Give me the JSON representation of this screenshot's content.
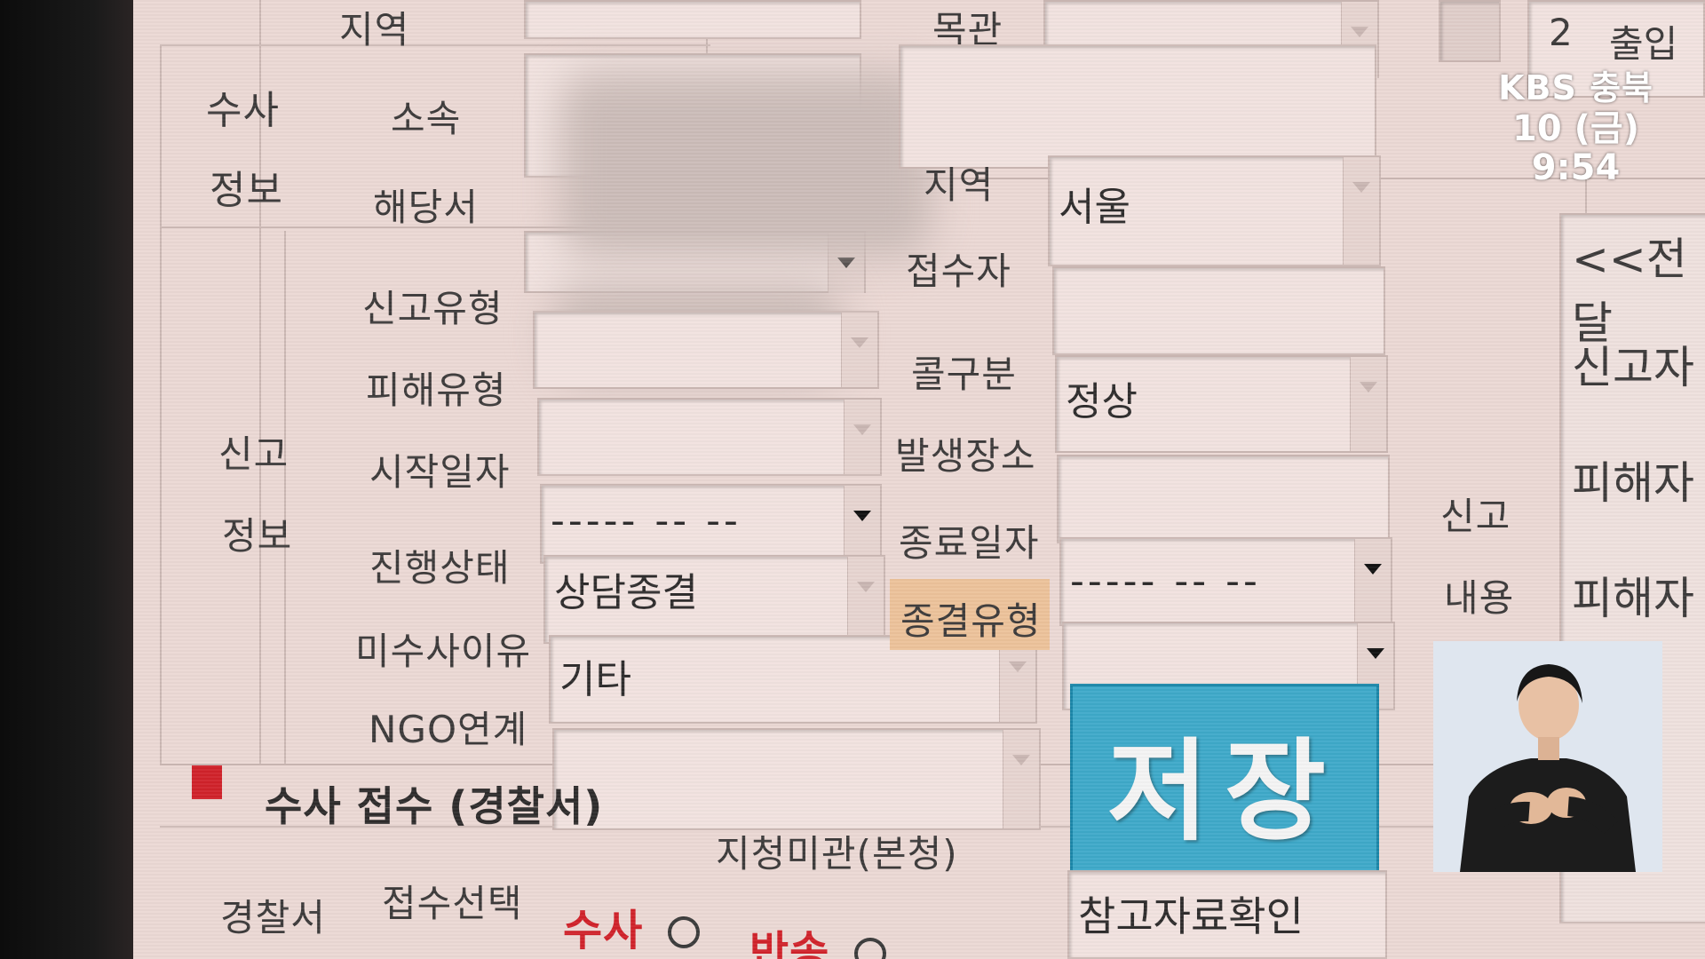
{
  "investigation_section": {
    "heading_line1": "수사",
    "heading_line2": "정보",
    "top_region_label": "지역",
    "affiliation_label": "소속",
    "station_label": "해당서",
    "top_right_label": "목관",
    "top_right_number": "2",
    "top_right_word": "출입"
  },
  "report_section": {
    "heading_line1": "신고",
    "heading_line2": "정보",
    "left_fields": [
      {
        "label": "신고유형",
        "value": ""
      },
      {
        "label": "피해유형",
        "value": ""
      },
      {
        "label": "시작일자",
        "value": "----- -- --"
      },
      {
        "label": "진행상태",
        "value": "상담종결"
      },
      {
        "label": "미수사이유",
        "value": "기타"
      },
      {
        "label": "NGO연계",
        "value": ""
      }
    ],
    "right_fields": [
      {
        "label": "지역",
        "value": "서울"
      },
      {
        "label": "접수자",
        "value": ""
      },
      {
        "label": "콜구분",
        "value": "정상"
      },
      {
        "label": "발생장소",
        "value": ""
      },
      {
        "label": "종료일자",
        "value": "----- -- --"
      },
      {
        "label": "종결유형",
        "value": ""
      }
    ]
  },
  "save_button": {
    "label": "저장"
  },
  "report_content": {
    "heading_line1": "신고",
    "heading_line2": "내용",
    "lines": [
      "<<전달",
      "신고자",
      "피해자",
      "피해자"
    ]
  },
  "police_section": {
    "title": "수사 접수 (경찰서)",
    "subtitle": "지청미관(본청)",
    "side_label": "경찰서",
    "selection_label": "접수선택",
    "option_investigate": "수사",
    "option_return": "반송",
    "reference_button": "참고자료확인",
    "badge_color": "#d0222a"
  },
  "broadcast": {
    "channel": "KBS 충북",
    "date": "10 (금)",
    "time": "9:54"
  },
  "colors": {
    "background": "#ebd8d4",
    "save_button": "#3ea9c9",
    "highlight": "#ecc29a"
  }
}
